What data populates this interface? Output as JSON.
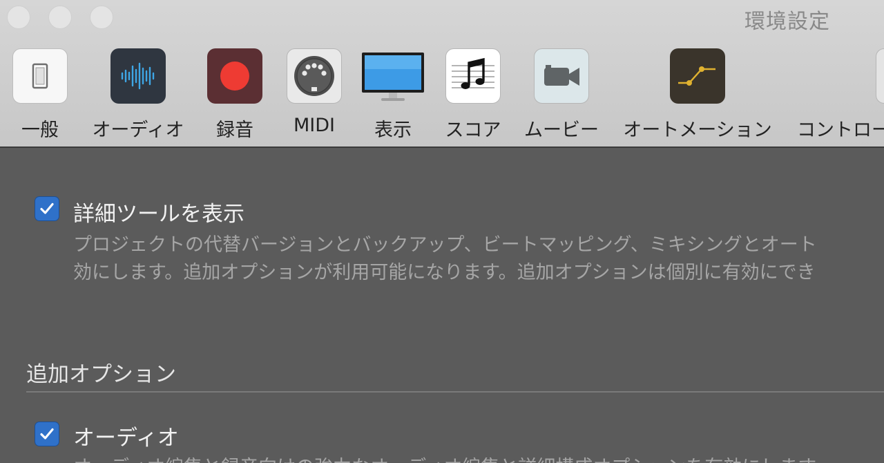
{
  "window": {
    "title": "環境設定"
  },
  "toolbar": {
    "items": [
      {
        "label": "一般",
        "icon": "switch-icon"
      },
      {
        "label": "オーディオ",
        "icon": "waveform-icon"
      },
      {
        "label": "録音",
        "icon": "record-icon"
      },
      {
        "label": "MIDI",
        "icon": "midi-connector-icon"
      },
      {
        "label": "表示",
        "icon": "monitor-icon"
      },
      {
        "label": "スコア",
        "icon": "music-note-icon"
      },
      {
        "label": "ムービー",
        "icon": "video-camera-icon"
      },
      {
        "label": "オートメーション",
        "icon": "automation-curve-icon"
      },
      {
        "label": "コントロー",
        "icon": "control-surface-icon"
      }
    ]
  },
  "content": {
    "advanced_tools": {
      "checked": true,
      "label": "詳細ツールを表示",
      "description_line1": "プロジェクトの代替バージョンとバックアップ、ビートマッピング、ミキシングとオート",
      "description_line2": "効にします。追加オプションが利用可能になります。追加オプションは個別に有効にでき"
    },
    "additional_options": {
      "title": "追加オプション",
      "audio": {
        "checked": true,
        "label": "オーディオ",
        "description": "オーディオ編集と録音向けの強力なオーディオ編集と詳細構成オプションを有効にします"
      }
    }
  },
  "colors": {
    "checkbox": "#2f71c9",
    "record": "#ee3b33",
    "automation": "#e0b230"
  }
}
